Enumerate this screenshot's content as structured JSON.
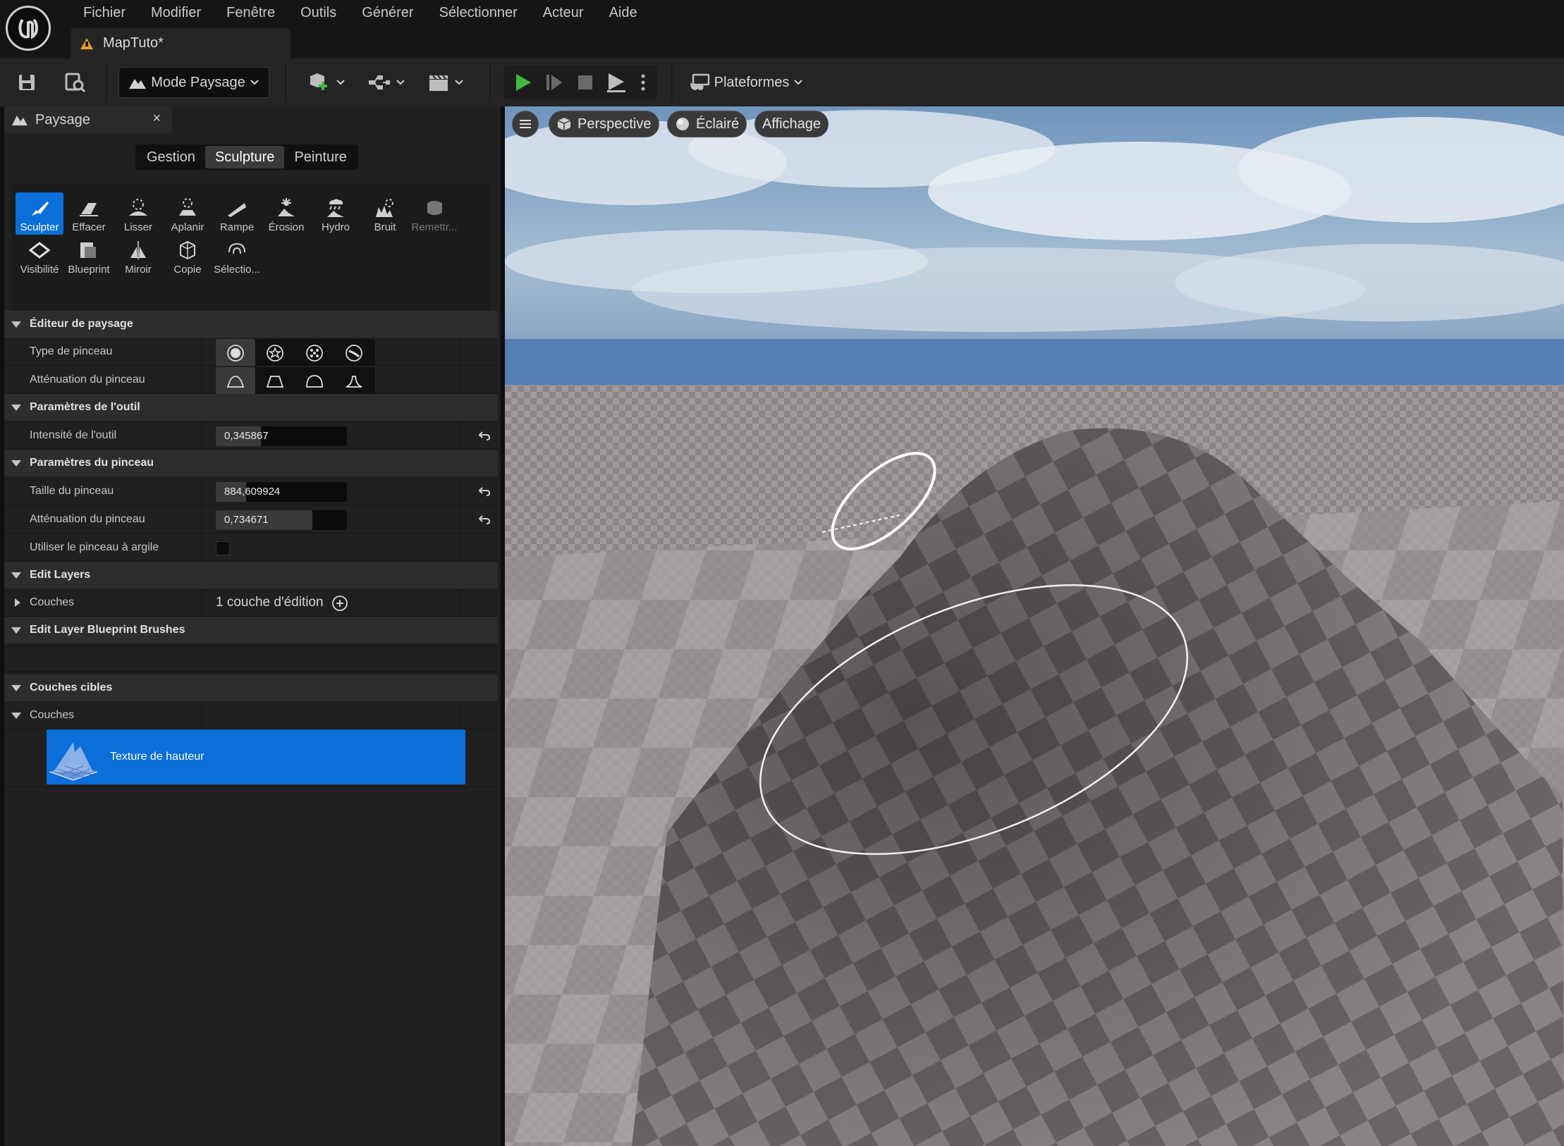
{
  "app": {
    "menu": [
      "Fichier",
      "Modifier",
      "Fenêtre",
      "Outils",
      "Générer",
      "Sélectionner",
      "Acteur",
      "Aide"
    ],
    "document_tab": "MapTuto*",
    "logo_icon": "unreal-engine-logo-icon"
  },
  "toolbar": {
    "mode_label": "Mode Paysage",
    "platforms_label": "Plateformes",
    "play_color": "#3fb83f"
  },
  "panel": {
    "title": "Paysage",
    "close": "×",
    "mode_tabs": [
      "Gestion",
      "Sculpture",
      "Peinture"
    ],
    "active_mode_tab": "Sculpture",
    "tools_row1": [
      "Sculpter",
      "Effacer",
      "Lisser",
      "Aplanir",
      "Rampe",
      "Érosion",
      "Hydro",
      "Bruit",
      "Remettr..."
    ],
    "tools_row2": [
      "Visibilité",
      "Blueprint",
      "Miroir",
      "Copie",
      "Sélectio..."
    ],
    "selected_tool": "Sculpter",
    "sections": {
      "editor": "Éditeur de paysage",
      "tool_params": "Paramètres de l'outil",
      "brush_params": "Paramètres du pinceau",
      "edit_layers": "Edit Layers",
      "bp_brushes": "Edit Layer Blueprint Brushes",
      "target_layers": "Couches cibles"
    },
    "props": {
      "brush_type": "Type de pinceau",
      "brush_falloff": "Atténuation du pinceau",
      "tool_strength": "Intensité de l'outil",
      "tool_strength_value": "0,345867",
      "tool_strength_fraction": 0.345867,
      "brush_size": "Taille du pinceau",
      "brush_size_value": "884,609924",
      "brush_size_fraction": 0.23,
      "brush_falloff2": "Atténuation du pinceau",
      "brush_falloff_value": "0,734671",
      "brush_falloff_fraction": 0.734671,
      "clay_brush": "Utiliser le pinceau à argile",
      "layers": "Couches",
      "layers_value": "1 couche d'édition",
      "target_layers": "Couches",
      "heightmap": "Texture de hauteur"
    }
  },
  "viewport": {
    "perspective": "Perspective",
    "lit": "Éclairé",
    "show": "Affichage"
  }
}
